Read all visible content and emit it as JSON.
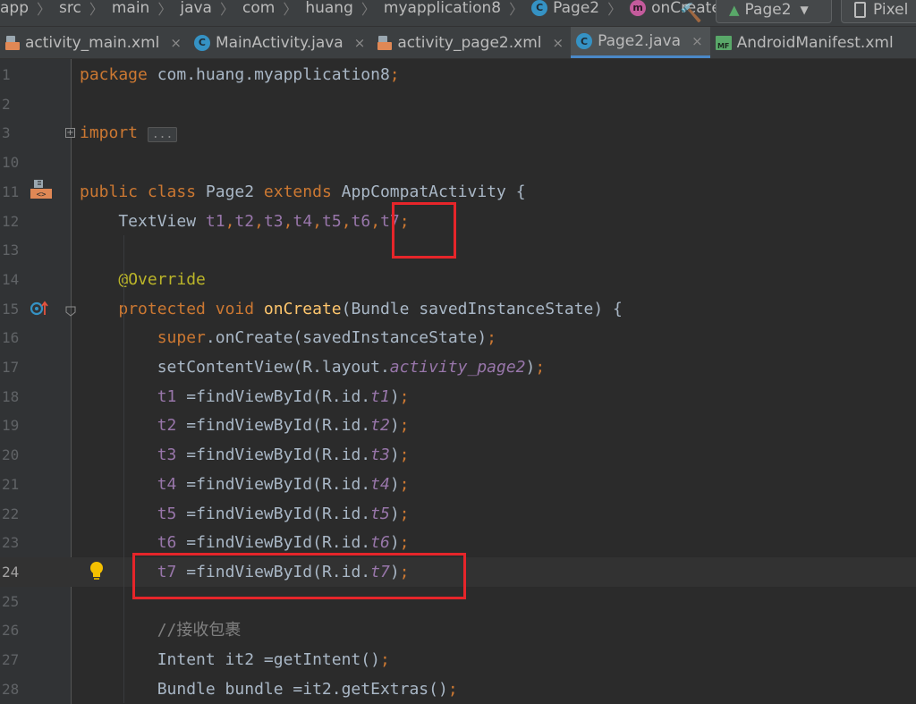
{
  "breadcrumb": {
    "items": [
      "app",
      "src",
      "main",
      "java",
      "com",
      "huang",
      "myapplication8"
    ],
    "class_item": "Page2",
    "method_item": "onCreate",
    "separator": "〉"
  },
  "toolbar": {
    "run_config": "Page2",
    "device": "Pixel"
  },
  "tabs": [
    {
      "label": "activity_main.xml",
      "icon": "xml-file-icon",
      "active": false
    },
    {
      "label": "MainActivity.java",
      "icon": "java-class-icon",
      "active": false
    },
    {
      "label": "activity_page2.xml",
      "icon": "xml-file-icon",
      "active": false
    },
    {
      "label": "Page2.java",
      "icon": "java-class-icon",
      "active": true
    },
    {
      "label": "AndroidManifest.xml",
      "icon": "manifest-file-icon",
      "active": false
    }
  ],
  "tab_close_glyph": "×",
  "editor": {
    "current_line": "24",
    "lines": [
      {
        "n": "1",
        "tokens": [
          [
            "kw",
            "package "
          ],
          [
            "",
            "com.huang.myapplication8"
          ],
          [
            "kw",
            ";"
          ]
        ]
      },
      {
        "n": "2",
        "tokens": []
      },
      {
        "n": "3",
        "tokens": [
          [
            "kw",
            "import "
          ],
          [
            "fold",
            "..."
          ]
        ]
      },
      {
        "n": "10",
        "tokens": []
      },
      {
        "n": "11",
        "tokens": [
          [
            "kw",
            "public class "
          ],
          [
            "",
            "Page2 "
          ],
          [
            "kw",
            "extends "
          ],
          [
            "",
            "AppCompatActivity {"
          ]
        ]
      },
      {
        "n": "12",
        "tokens": [
          [
            "",
            "    TextView "
          ],
          [
            "fld",
            "t1"
          ],
          [
            "kw",
            ","
          ],
          [
            "fld",
            "t2"
          ],
          [
            "kw",
            ","
          ],
          [
            "fld",
            "t3"
          ],
          [
            "kw",
            ","
          ],
          [
            "fld",
            "t4"
          ],
          [
            "kw",
            ","
          ],
          [
            "fld",
            "t5"
          ],
          [
            "kw",
            ","
          ],
          [
            "fld",
            "t6"
          ],
          [
            "kw",
            ","
          ],
          [
            "fld",
            "t7"
          ],
          [
            "kw",
            ";"
          ]
        ]
      },
      {
        "n": "13",
        "tokens": []
      },
      {
        "n": "14",
        "tokens": [
          [
            "",
            "    "
          ],
          [
            "ann",
            "@Override"
          ]
        ]
      },
      {
        "n": "15",
        "tokens": [
          [
            "",
            "    "
          ],
          [
            "kw",
            "protected void "
          ],
          [
            "fn",
            "onCreate"
          ],
          [
            "",
            "(Bundle savedInstanceState) {"
          ]
        ]
      },
      {
        "n": "16",
        "tokens": [
          [
            "",
            "        "
          ],
          [
            "kw",
            "super"
          ],
          [
            "",
            ".onCreate(savedInstanceState)"
          ],
          [
            "kw",
            ";"
          ]
        ]
      },
      {
        "n": "17",
        "tokens": [
          [
            "",
            "        setContentView(R.layout."
          ],
          [
            "fld-i",
            "activity_page2"
          ],
          [
            "",
            ")"
          ],
          [
            "kw",
            ";"
          ]
        ]
      },
      {
        "n": "18",
        "tokens": [
          [
            "",
            "        "
          ],
          [
            "fld",
            "t1"
          ],
          [
            "",
            " =findViewById(R.id."
          ],
          [
            "fld-i",
            "t1"
          ],
          [
            "",
            ")"
          ],
          [
            "kw",
            ";"
          ]
        ]
      },
      {
        "n": "19",
        "tokens": [
          [
            "",
            "        "
          ],
          [
            "fld",
            "t2"
          ],
          [
            "",
            " =findViewById(R.id."
          ],
          [
            "fld-i",
            "t2"
          ],
          [
            "",
            ")"
          ],
          [
            "kw",
            ";"
          ]
        ]
      },
      {
        "n": "20",
        "tokens": [
          [
            "",
            "        "
          ],
          [
            "fld",
            "t3"
          ],
          [
            "",
            " =findViewById(R.id."
          ],
          [
            "fld-i",
            "t3"
          ],
          [
            "",
            ")"
          ],
          [
            "kw",
            ";"
          ]
        ]
      },
      {
        "n": "21",
        "tokens": [
          [
            "",
            "        "
          ],
          [
            "fld",
            "t4"
          ],
          [
            "",
            " =findViewById(R.id."
          ],
          [
            "fld-i",
            "t4"
          ],
          [
            "",
            ")"
          ],
          [
            "kw",
            ";"
          ]
        ]
      },
      {
        "n": "22",
        "tokens": [
          [
            "",
            "        "
          ],
          [
            "fld",
            "t5"
          ],
          [
            "",
            " =findViewById(R.id."
          ],
          [
            "fld-i",
            "t5"
          ],
          [
            "",
            ")"
          ],
          [
            "kw",
            ";"
          ]
        ]
      },
      {
        "n": "23",
        "tokens": [
          [
            "",
            "        "
          ],
          [
            "fld",
            "t6"
          ],
          [
            "",
            " =findViewById(R.id."
          ],
          [
            "fld-i",
            "t6"
          ],
          [
            "",
            ")"
          ],
          [
            "kw",
            ";"
          ]
        ]
      },
      {
        "n": "24",
        "tokens": [
          [
            "",
            "        "
          ],
          [
            "fld",
            "t7"
          ],
          [
            "",
            " =findViewById(R.id."
          ],
          [
            "fld-i",
            "t7"
          ],
          [
            "",
            ")"
          ],
          [
            "kw",
            ";"
          ]
        ]
      },
      {
        "n": "25",
        "tokens": []
      },
      {
        "n": "26",
        "tokens": [
          [
            "",
            "        "
          ],
          [
            "cmt",
            "//接收包裹"
          ]
        ]
      },
      {
        "n": "27",
        "tokens": [
          [
            "",
            "        Intent it2 =getIntent()"
          ],
          [
            "kw",
            ";"
          ]
        ]
      },
      {
        "n": "28",
        "tokens": [
          [
            "",
            "        Bundle bundle =it2.getExtras()"
          ],
          [
            "kw",
            ";"
          ]
        ]
      }
    ]
  },
  "colors": {
    "background": "#2b2b2b",
    "gutter": "#313335",
    "keyword": "#cc7832",
    "annotation": "#bbb529",
    "method": "#ffc66d",
    "field": "#9876aa",
    "comment": "#808080",
    "highlight_box": "#e6252a"
  }
}
